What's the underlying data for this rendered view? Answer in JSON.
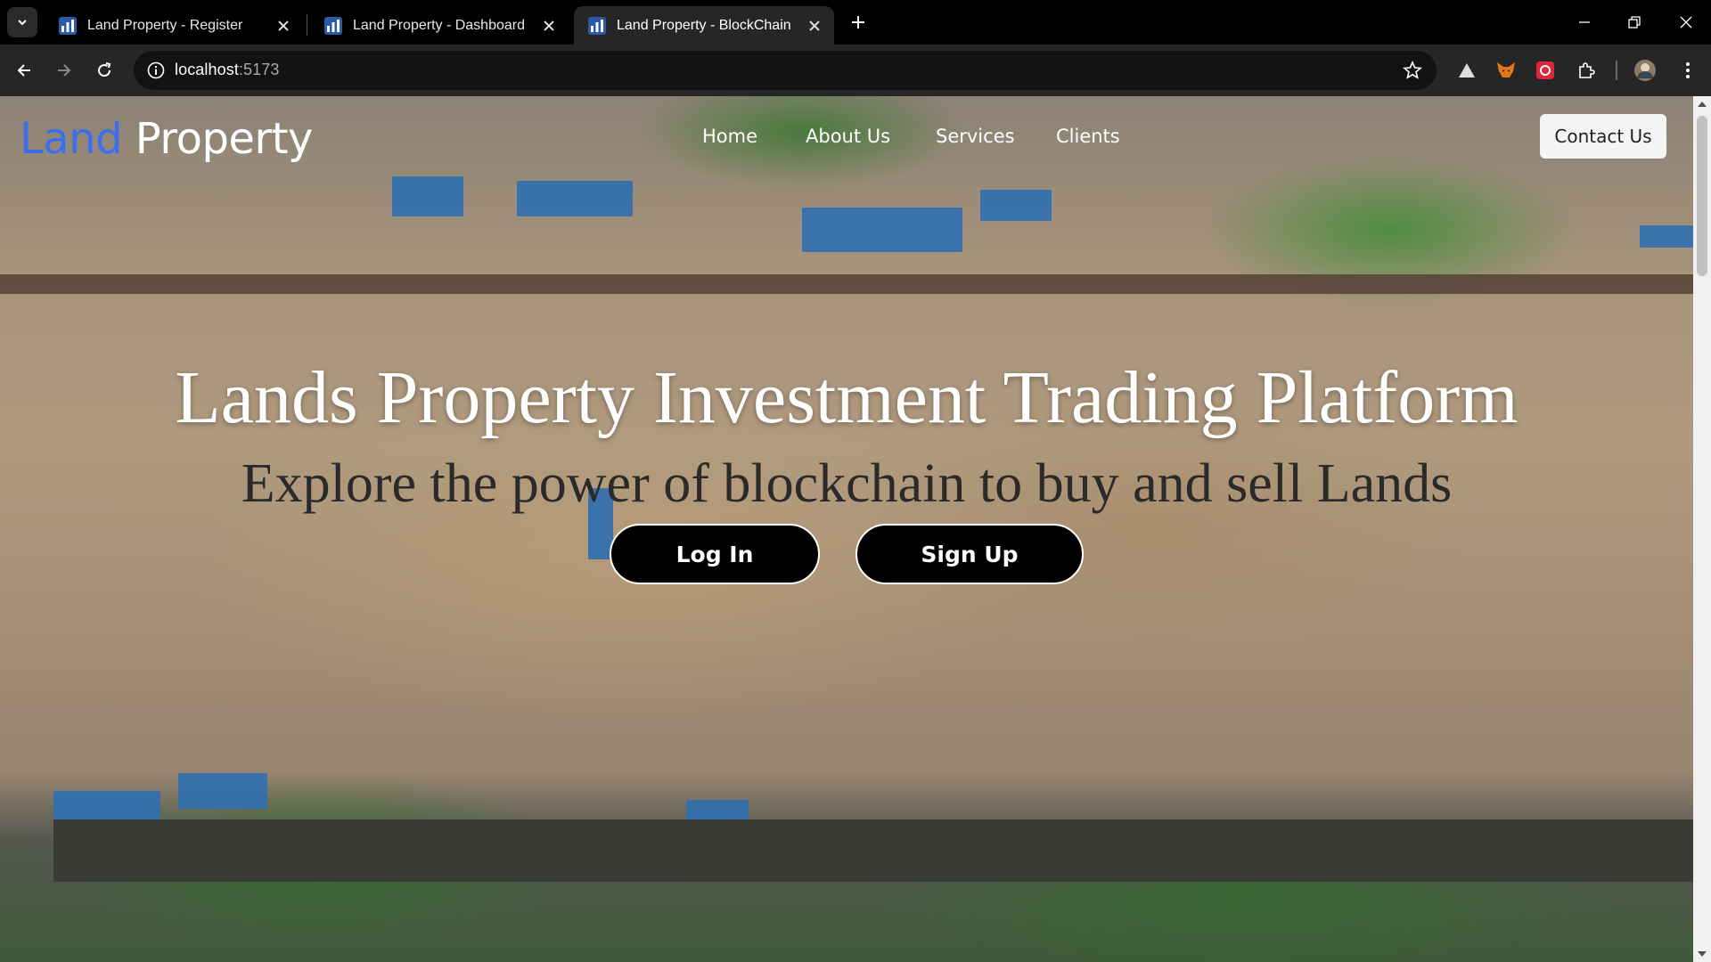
{
  "browser": {
    "tabs": [
      {
        "title": "Land Property - Register"
      },
      {
        "title": "Land Property - Dashboard"
      },
      {
        "title": "Land Property - BlockChain"
      }
    ],
    "url_host": "localhost",
    "url_port": ":5173"
  },
  "site": {
    "logo_accent": "Land",
    "logo_rest": " Property",
    "nav": [
      "Home",
      "About Us",
      "Services",
      "Clients"
    ],
    "contact_label": "Contact Us",
    "hero_title": "Lands Property Investment Trading Platform",
    "hero_subtitle": "Explore the power of blockchain to buy and sell Lands",
    "login_label": "Log In",
    "signup_label": "Sign Up"
  },
  "colors": {
    "logo_accent": "#3b6ff0",
    "cta_bg": "#000000"
  }
}
